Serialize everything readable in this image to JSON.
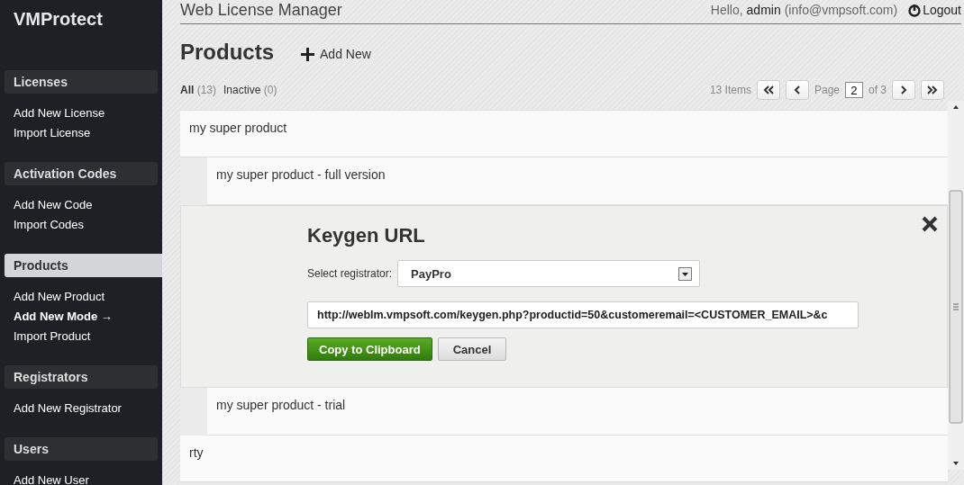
{
  "sidebar": {
    "logo": "VMProtect",
    "sections": [
      {
        "title": "Licenses",
        "selected": false,
        "items": [
          {
            "label": "Add New License",
            "active": false
          },
          {
            "label": "Import License",
            "active": false
          }
        ]
      },
      {
        "title": "Activation Codes",
        "selected": false,
        "items": [
          {
            "label": "Add New Code",
            "active": false
          },
          {
            "label": "Import Codes",
            "active": false
          }
        ]
      },
      {
        "title": "Products",
        "selected": true,
        "items": [
          {
            "label": "Add New Product",
            "active": false
          },
          {
            "label": "Add New Mode →",
            "active": true
          },
          {
            "label": "Import Product",
            "active": false
          }
        ]
      },
      {
        "title": "Registrators",
        "selected": false,
        "items": [
          {
            "label": "Add New Registrator",
            "active": false
          }
        ]
      },
      {
        "title": "Users",
        "selected": false,
        "items": [
          {
            "label": "Add New User",
            "active": false
          }
        ]
      }
    ]
  },
  "header": {
    "title": "Web License Manager",
    "greeting": "Hello,",
    "user": "admin",
    "email": "(info@vmpsoft.com)",
    "logout": "Logout"
  },
  "page": {
    "title": "Products",
    "add_new": "Add New"
  },
  "filters": [
    {
      "label": "All",
      "count": "(13)",
      "selected": true
    },
    {
      "label": "Inactive",
      "count": "(0)",
      "selected": false
    }
  ],
  "pagination": {
    "items": "13 Items",
    "page_label": "Page",
    "page": "2",
    "of": "of 3"
  },
  "products": [
    {
      "name": "my super product",
      "children": [
        {
          "kind": "mode",
          "name": "my super product - full version"
        },
        {
          "kind": "keygen",
          "title": "Keygen URL",
          "registrator_label": "Select registrator:",
          "registrator": "PayPro",
          "url": "http://weblm.vmpsoft.com/keygen.php?productid=50&customeremail=<CUSTOMER_EMAIL>&c",
          "copy": "Copy to Clipboard",
          "cancel": "Cancel"
        },
        {
          "kind": "mode",
          "name": "my super product - trial"
        }
      ]
    },
    {
      "name": "rty"
    }
  ]
}
